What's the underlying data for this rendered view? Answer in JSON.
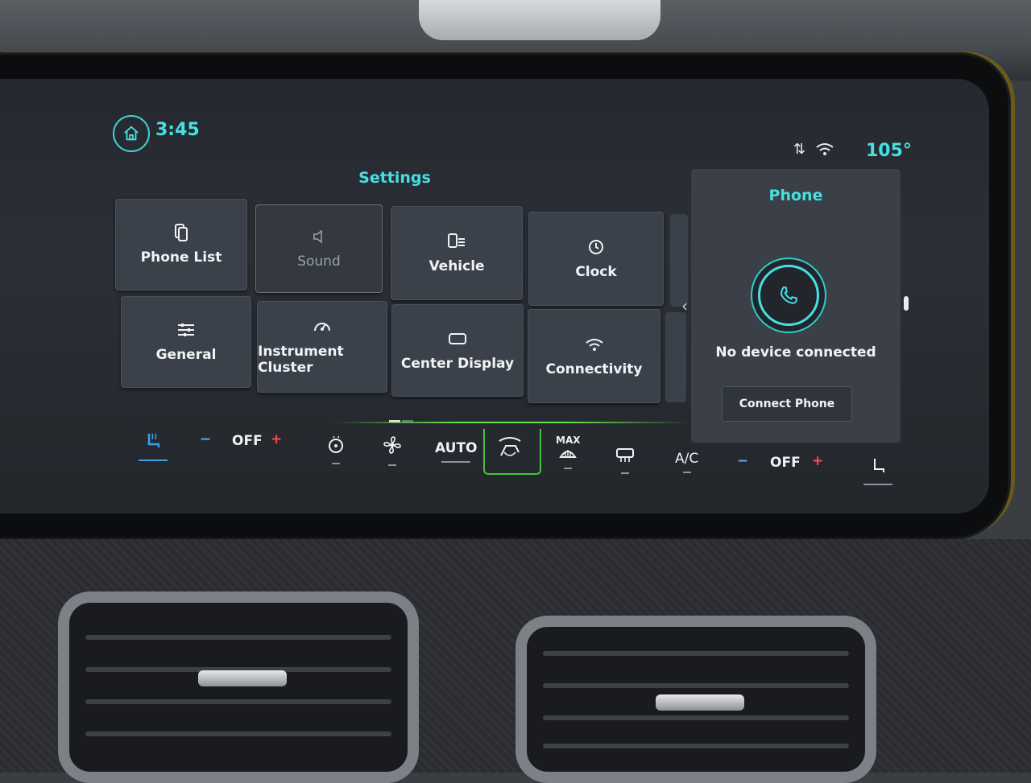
{
  "status_bar": {
    "time": "3:45",
    "temperature": "105°",
    "icons": [
      "home-icon",
      "data-transfer-icon",
      "wifi-hotspot-icon"
    ]
  },
  "settings": {
    "title": "Settings",
    "tiles": [
      {
        "label": "Phone List",
        "icon": "phone-list-icon",
        "enabled": true
      },
      {
        "label": "Sound",
        "icon": "speaker-icon",
        "enabled": false
      },
      {
        "label": "Vehicle",
        "icon": "vehicle-settings-icon",
        "enabled": true
      },
      {
        "label": "Clock",
        "icon": "clock-icon",
        "enabled": true
      },
      {
        "label": "General",
        "icon": "sliders-icon",
        "enabled": true
      },
      {
        "label": "Instrument Cluster",
        "icon": "gauge-icon",
        "enabled": true
      },
      {
        "label": "Center Display",
        "icon": "display-icon",
        "enabled": true
      },
      {
        "label": "Connectivity",
        "icon": "wifi-icon",
        "enabled": true
      }
    ]
  },
  "phone_panel": {
    "title": "Phone",
    "status": "No device connected",
    "button": "Connect Phone"
  },
  "climate": {
    "driver_fan": "OFF",
    "auto": "AUTO",
    "max": "MAX",
    "ac": "A/C",
    "passenger_fan": "OFF",
    "minus": "−",
    "plus": "+"
  },
  "colors": {
    "accent": "#46e0e2",
    "tile": "#3b414b",
    "active_green": "#43c43a"
  }
}
